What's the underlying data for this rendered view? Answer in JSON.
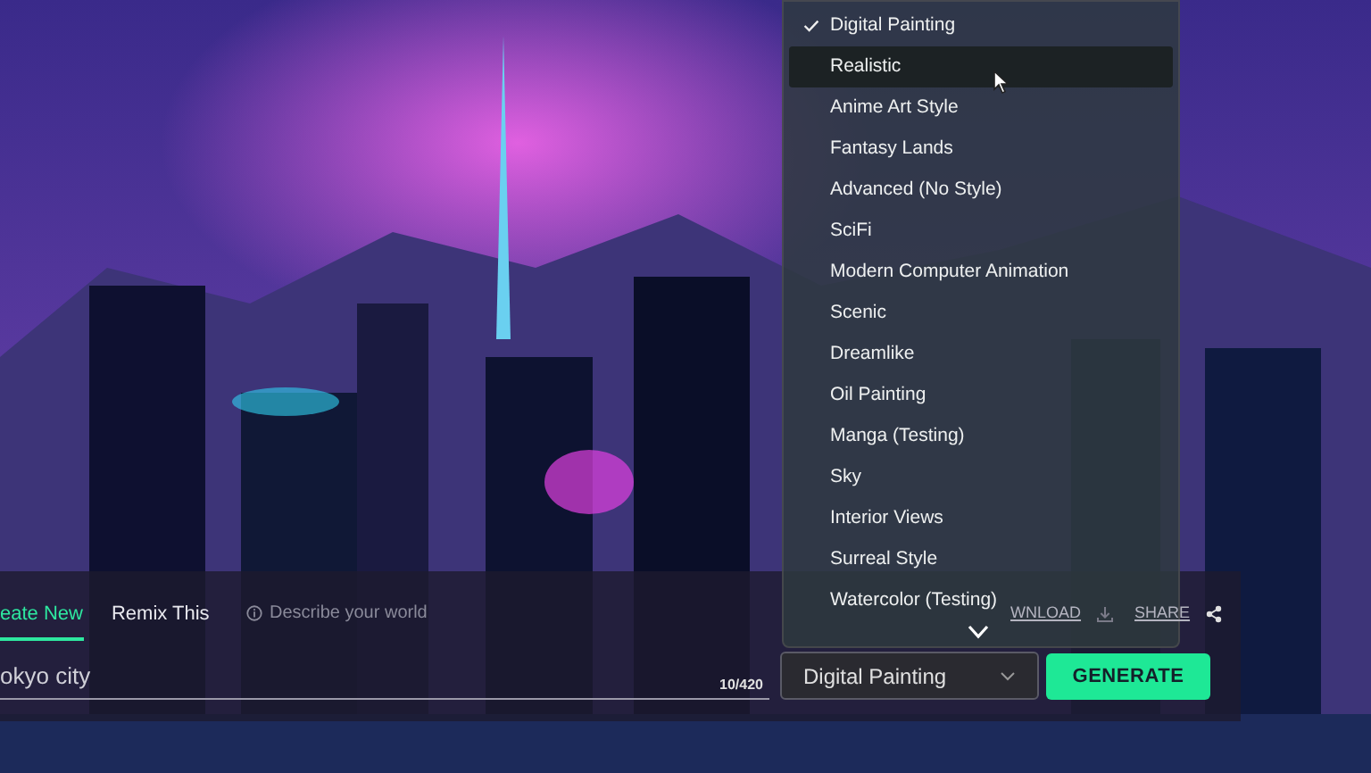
{
  "tabs": [
    {
      "label": "eate New",
      "selected": true
    },
    {
      "label": "Remix This",
      "selected": false
    }
  ],
  "hint": "Describe your world",
  "prompt": {
    "value": "okyo city",
    "counter": "10/420"
  },
  "actions": [
    {
      "kind": "download",
      "label": "WNLOAD"
    },
    {
      "kind": "share",
      "label": "SHARE"
    }
  ],
  "style_select": {
    "value": "Digital Painting"
  },
  "generate_button": "GENERATE",
  "style_menu": [
    {
      "label": "Digital Painting",
      "checked": true,
      "selected": false
    },
    {
      "label": "Realistic",
      "checked": false,
      "selected": true
    },
    {
      "label": "Anime Art Style",
      "checked": false,
      "selected": false
    },
    {
      "label": "Fantasy Lands",
      "checked": false,
      "selected": false
    },
    {
      "label": "Advanced (No Style)",
      "checked": false,
      "selected": false
    },
    {
      "label": "SciFi",
      "checked": false,
      "selected": false
    },
    {
      "label": "Modern Computer Animation",
      "checked": false,
      "selected": false
    },
    {
      "label": "Scenic",
      "checked": false,
      "selected": false
    },
    {
      "label": "Dreamlike",
      "checked": false,
      "selected": false
    },
    {
      "label": "Oil Painting",
      "checked": false,
      "selected": false
    },
    {
      "label": "Manga (Testing)",
      "checked": false,
      "selected": false
    },
    {
      "label": "Sky",
      "checked": false,
      "selected": false
    },
    {
      "label": "Interior Views",
      "checked": false,
      "selected": false
    },
    {
      "label": "Surreal Style",
      "checked": false,
      "selected": false
    },
    {
      "label": "Watercolor (Testing)",
      "checked": false,
      "selected": false
    }
  ]
}
